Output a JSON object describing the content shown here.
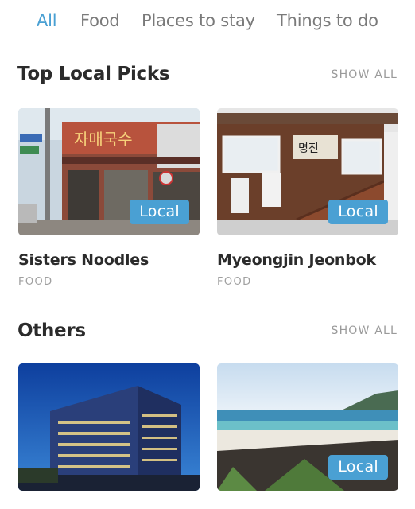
{
  "tabs": [
    {
      "label": "All"
    },
    {
      "label": "Food"
    },
    {
      "label": "Places to stay"
    },
    {
      "label": "Things to do"
    }
  ],
  "colors": {
    "accent": "#4aa0d3",
    "text": "#2b2b2b",
    "muted": "#9a9a9a"
  },
  "top_picks": {
    "title": "Top Local Picks",
    "show_all": "SHOW ALL",
    "cards": [
      {
        "name": "Sisters Noodles",
        "category": "FOOD",
        "badge": "Local"
      },
      {
        "name": "Myeongjin Jeonbok",
        "category": "FOOD",
        "badge": "Local"
      }
    ]
  },
  "others": {
    "title": "Others",
    "show_all": "SHOW ALL",
    "cards": [
      {
        "badge": null
      },
      {
        "badge": "Local"
      }
    ]
  }
}
